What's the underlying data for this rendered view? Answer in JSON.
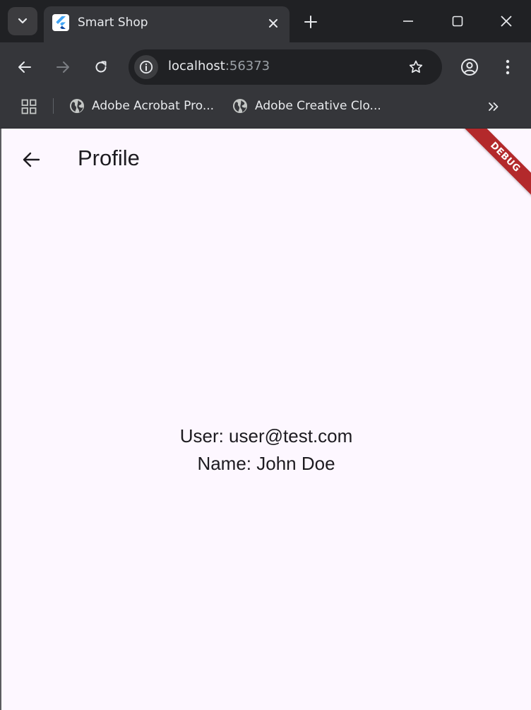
{
  "browser": {
    "tab": {
      "title": "Smart Shop"
    },
    "omnibox": {
      "host": "localhost",
      "port": ":56373"
    },
    "bookmarks": [
      {
        "label": "Adobe Acrobat Pro..."
      },
      {
        "label": "Adobe Creative Clo..."
      }
    ],
    "icons": {
      "tab_search": "chevron-down-icon",
      "favicon": "flutter-logo-icon",
      "tab_close": "close-icon",
      "new_tab": "plus-icon",
      "minimize": "minimize-icon",
      "maximize": "maximize-icon",
      "window_close": "close-icon",
      "back": "arrow-left-icon",
      "forward": "arrow-right-icon",
      "reload": "reload-icon",
      "site_info": "info-icon",
      "bookmark_star": "star-outline-icon",
      "profile": "account-circle-icon",
      "menu": "more-vert-icon",
      "apps": "apps-grid-icon",
      "bookmark_globe": "globe-icon",
      "bookmarks_overflow": "double-chevron-right-icon"
    }
  },
  "app": {
    "appbar": {
      "title": "Profile",
      "back_icon": "arrow-left-icon"
    },
    "profile": {
      "user_line": "User: user@test.com",
      "name_line": "Name: John Doe"
    },
    "debug_banner": "DEBUG"
  },
  "colors": {
    "chrome_frame": "#202124",
    "chrome_toolbar": "#35363a",
    "page_background": "#fdf7ff",
    "debug_banner": "#b3292b",
    "text_dark": "#1d1b20"
  }
}
